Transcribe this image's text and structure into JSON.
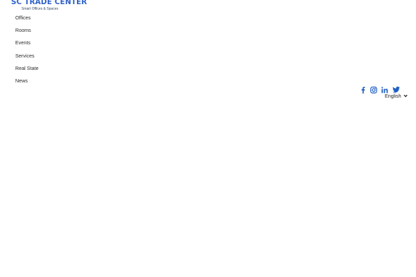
{
  "brand": {
    "title": "SC TRADE CENTER",
    "tagline": "Smart Offices & Spaces",
    "color": "#2f62c8"
  },
  "nav": {
    "items": [
      {
        "label": "Offices"
      },
      {
        "label": "Rooms"
      },
      {
        "label": "Events"
      },
      {
        "label": "Services"
      },
      {
        "label": "Real State"
      },
      {
        "label": "News"
      }
    ]
  },
  "social": {
    "icons": [
      "facebook-icon",
      "instagram-icon",
      "linkedin-icon",
      "twitter-icon"
    ],
    "color": "#1f5fc4"
  },
  "language": {
    "selected": "English",
    "icon": "chevron-down-icon"
  }
}
